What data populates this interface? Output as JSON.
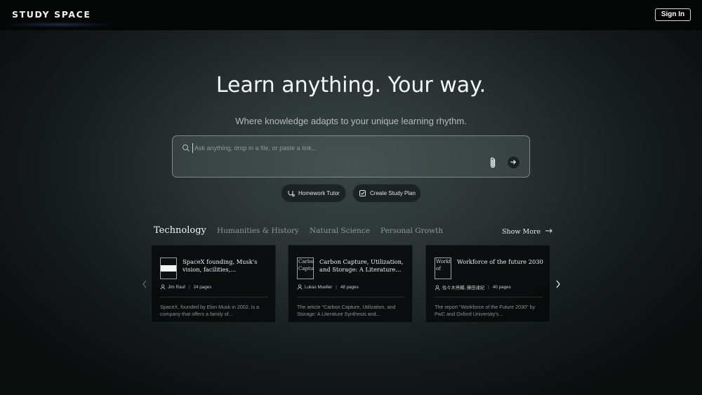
{
  "header": {
    "brand": "STUDY SPACE",
    "sign_in": "Sign In"
  },
  "hero": {
    "title": "Learn anything. Your way.",
    "subtitle": "Where knowledge adapts to your unique learning rhythm."
  },
  "search": {
    "placeholder": "Ask anything, drop in a file, or paste a link...",
    "value": ""
  },
  "chips": [
    {
      "label": "Homework Tutor",
      "icon": "tutor-icon"
    },
    {
      "label": "Create Study Plan",
      "icon": "study-plan-icon"
    }
  ],
  "tabs": [
    {
      "label": "Technology",
      "active": true
    },
    {
      "label": "Humanities & History",
      "active": false
    },
    {
      "label": "Natural Science",
      "active": false
    },
    {
      "label": "Personal Growth",
      "active": false
    }
  ],
  "show_more": "Show More",
  "cards": [
    {
      "thumb_alt": "",
      "title": "SpaceX founding, Musk's vision, facilities,...",
      "author": "Jim Rauf",
      "pages": "24 pages",
      "description": "SpaceX, founded by Elon Musk in 2002, is a company that offers a family of..."
    },
    {
      "thumb_alt": "Carbon Capture",
      "title": "Carbon Capture, Utilization, and Storage: A Literature...",
      "author": "Lukas Mueller",
      "pages": "48 pages",
      "description": "The article \"Carbon Capture, Utilization, and Storage: A Literature Synthesis and..."
    },
    {
      "thumb_alt": "Workforce of",
      "title": "Workforce of the future 2030",
      "author": "佐々木亮輔, 藤田達紀",
      "pages": "40 pages",
      "description": "The report \"Workforce of the Future 2030\" by PwC and Oxford University's..."
    }
  ],
  "colors": {
    "topbar": "#050606",
    "card_bg": "#080a0a",
    "text_primary": "#f0f3f2",
    "text_muted": "#8a9491"
  }
}
